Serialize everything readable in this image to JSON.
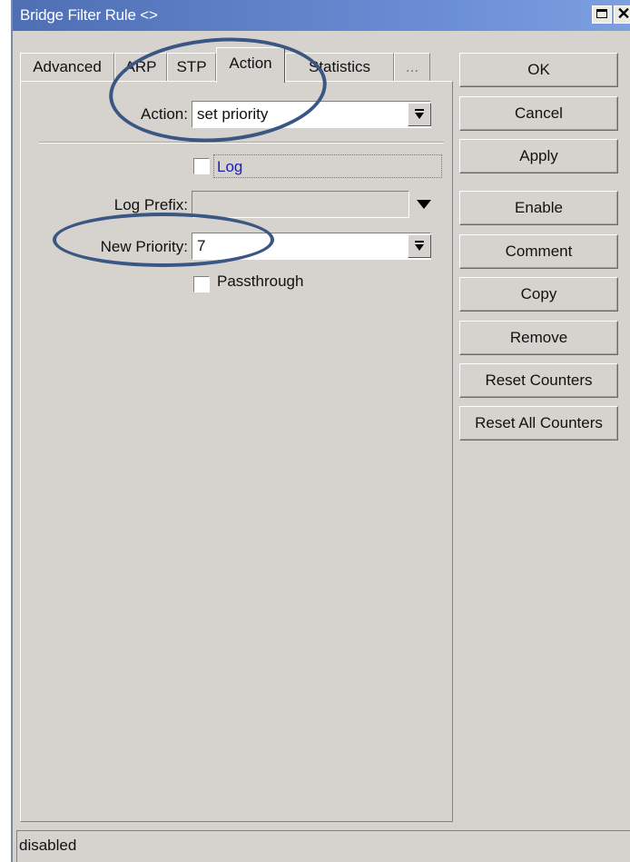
{
  "window": {
    "title": "Bridge Filter Rule <>"
  },
  "tabs": [
    {
      "label": "Advanced"
    },
    {
      "label": "ARP"
    },
    {
      "label": "STP"
    },
    {
      "label": "Action"
    },
    {
      "label": "Statistics"
    },
    {
      "label": "..."
    }
  ],
  "form": {
    "action_label": "Action:",
    "action_value": "set priority",
    "log_label": "Log",
    "log_prefix_label": "Log Prefix:",
    "log_prefix_value": "",
    "new_priority_label": "New Priority:",
    "new_priority_value": "7",
    "passthrough_label": "Passthrough"
  },
  "buttons": {
    "ok": "OK",
    "cancel": "Cancel",
    "apply": "Apply",
    "enable": "Enable",
    "comment": "Comment",
    "copy": "Copy",
    "remove": "Remove",
    "reset_counters": "Reset Counters",
    "reset_all_counters": "Reset All Counters"
  },
  "status": {
    "text": "disabled"
  },
  "colors": {
    "title_bar": "#5a7cc4",
    "window_bg": "#d6d3ce",
    "annotation_oval": "#3a5683",
    "link_blue": "#1c1cb8"
  }
}
